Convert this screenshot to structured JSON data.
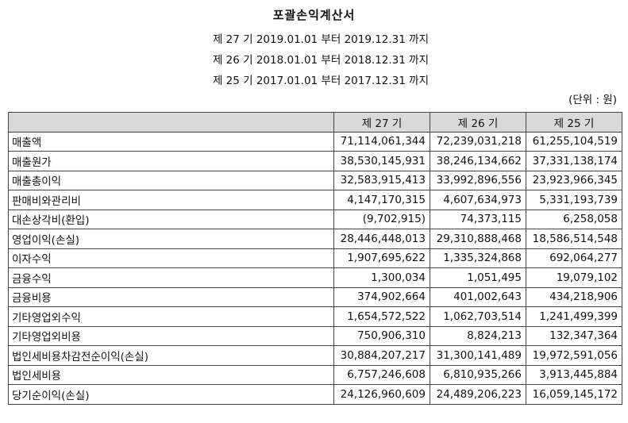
{
  "title": "포괄손익계산서",
  "periods": [
    "제 27 기 2019.01.01 부터 2019.12.31 까지",
    "제 26 기 2018.01.01 부터 2018.12.31 까지",
    "제 25 기 2017.01.01 부터 2017.12.31 까지"
  ],
  "unit": "(단위 : 원)",
  "table": {
    "headers": [
      "",
      "제 27 기",
      "제 26 기",
      "제 25 기"
    ],
    "rows": [
      [
        "매출액",
        "71,114,061,344",
        "72,239,031,218",
        "61,255,104,519"
      ],
      [
        "매출원가",
        "38,530,145,931",
        "38,246,134,662",
        "37,331,138,174"
      ],
      [
        "매출총이익",
        "32,583,915,413",
        "33,992,896,556",
        "23,923,966,345"
      ],
      [
        "판매비와관리비",
        "4,147,170,315",
        "4,607,634,973",
        "5,331,193,739"
      ],
      [
        "대손상각비(환입)",
        "(9,702,915)",
        "74,373,115",
        "6,258,058"
      ],
      [
        "영업이익(손실)",
        "28,446,448,013",
        "29,310,888,468",
        "18,586,514,548"
      ],
      [
        "이자수익",
        "1,907,695,622",
        "1,335,324,868",
        "692,064,277"
      ],
      [
        "금융수익",
        "1,300,034",
        "1,051,495",
        "19,079,102"
      ],
      [
        "금융비용",
        "374,902,664",
        "401,002,643",
        "434,218,906"
      ],
      [
        "기타영업외수익",
        "1,654,572,522",
        "1,062,703,514",
        "1,241,499,399"
      ],
      [
        "기타영업외비용",
        "750,906,310",
        "8,824,213",
        "132,347,364"
      ],
      [
        "법인세비용차감전순이익(손실)",
        "30,884,207,217",
        "31,300,141,489",
        "19,972,591,056"
      ],
      [
        "법인세비용",
        "6,757,246,608",
        "6,810,935,266",
        "3,913,445,884"
      ],
      [
        "당기순이익(손실)",
        "24,126,960,609",
        "24,489,206,223",
        "16,059,145,172"
      ]
    ]
  }
}
